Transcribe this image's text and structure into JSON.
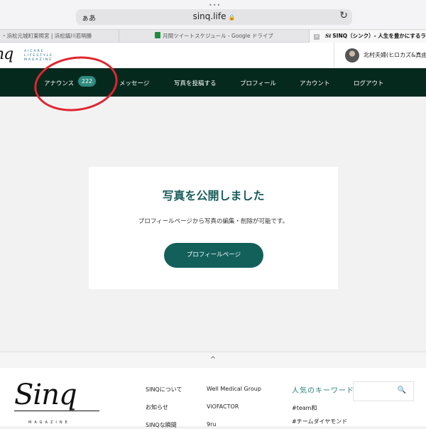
{
  "browser": {
    "dots": "•••",
    "text_size_label": "ぁあ",
    "url": "sinq.life",
    "lock": "🔒",
    "reload": "↻",
    "tabs": [
      {
        "label": "・浜松元城町東照宮 | 浜松鎮川若明勝"
      },
      {
        "label": "月間ツイートスケジュール - Google ドライブ"
      },
      {
        "label": "SINQ（シンク）- 人生を豊かにするライフ",
        "close": "✕",
        "brand": "Si"
      }
    ]
  },
  "header": {
    "logo": "nq",
    "tagline": "AICARE LIFESTYLE MAGAZINE",
    "user_name": "北村夫婦(ヒロカズ&真由"
  },
  "nav": {
    "items": [
      {
        "label": "アナウンス"
      },
      {
        "label": "メッセージ"
      },
      {
        "label": "写真を投稿する"
      },
      {
        "label": "プロフィール"
      },
      {
        "label": "アカウント"
      },
      {
        "label": "ログアウト"
      }
    ],
    "badge_count": "222"
  },
  "card": {
    "title": "写真を公開しました",
    "description": "プロフィールページから写真の編集・削除が可能です。",
    "button_label": "プロフィールページ"
  },
  "footer": {
    "scroll_top": "^",
    "logo": "Sinq",
    "magazine": "MAGAZINE",
    "col1": [
      "SINQについて",
      "お知らせ",
      "SINQな瞬間"
    ],
    "col2": [
      "Well Medical Group",
      "ViOFACTOR",
      "9ru"
    ],
    "keywords_title": "人気のキーワード",
    "keywords": [
      "#team和",
      "#チームダイヤモンド"
    ],
    "search_icon": "🔍"
  },
  "colors": {
    "nav_bg": "#06291e",
    "accent": "#13605b",
    "badge": "#2f8a80",
    "annotation": "#e0252f"
  }
}
